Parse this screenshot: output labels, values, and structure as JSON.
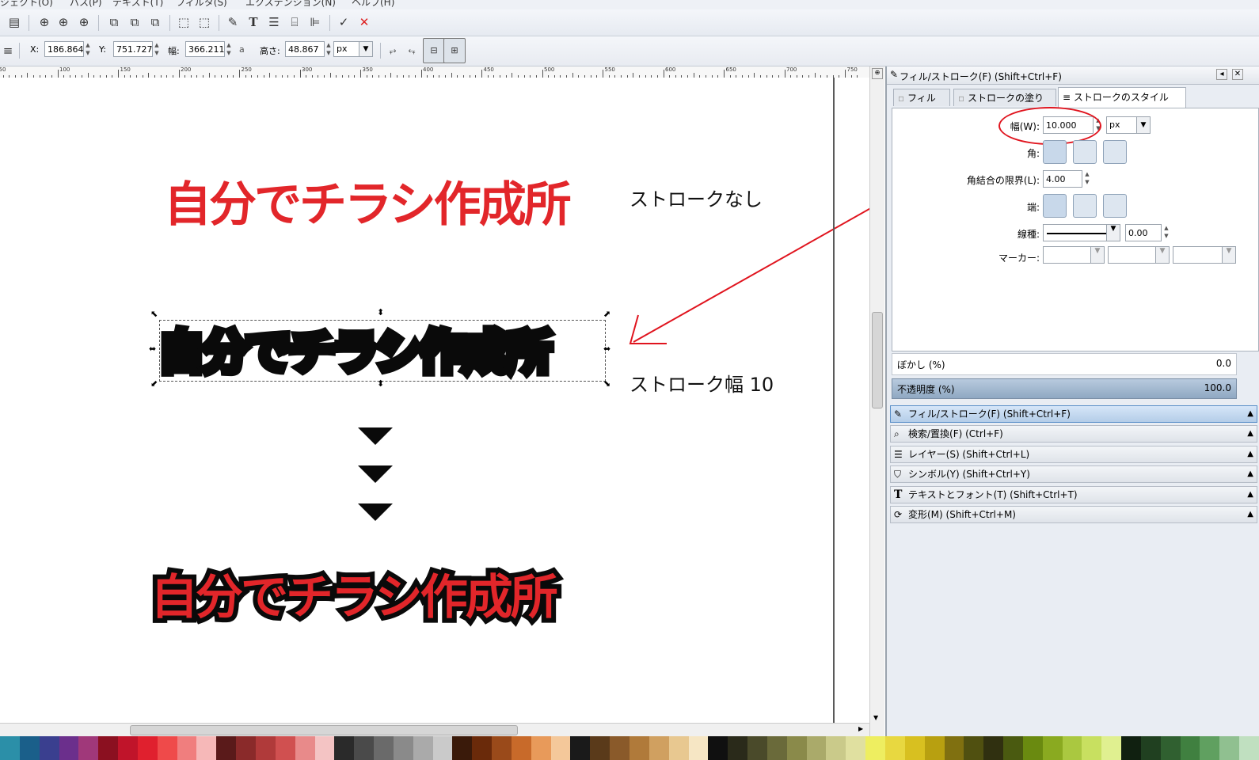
{
  "menubar": {
    "items": [
      "ジェクト(O)",
      "パス(P)",
      "テキスト(T)",
      "フィルタ(S)",
      "エクステンション(N)",
      "ヘルプ(H)"
    ]
  },
  "toolbar_controls": {
    "x_label": "X:",
    "x_value": "186.864",
    "y_label": "Y:",
    "y_value": "751.727",
    "w_label": "幅:",
    "w_value": "366.211",
    "h_label": "高さ:",
    "h_value": "48.867",
    "unit": "px"
  },
  "ruler": {
    "labels": [
      "50",
      "100",
      "150",
      "200",
      "250",
      "300",
      "350",
      "400",
      "450",
      "500",
      "550",
      "600",
      "650",
      "700",
      "750"
    ]
  },
  "canvas": {
    "title_text": "自分でチラシ作成所",
    "label_no_stroke": "ストロークなし",
    "label_stroke_width": "ストローク幅 10",
    "colors": {
      "red": "#e2262a",
      "black": "#0a0a0a"
    }
  },
  "panel": {
    "title": "フィル/ストローク(F) (Shift+Ctrl+F)",
    "tabs": [
      {
        "label": "フィル(F)"
      },
      {
        "label": "ストロークの塗り(P)"
      },
      {
        "label": "ストロークのスタイル(Y)"
      }
    ],
    "width_label": "幅(W):",
    "width_value": "10.000",
    "width_unit": "px",
    "join_label": "角:",
    "miter_label": "角結合の限界(L):",
    "miter_value": "4.00",
    "cap_label": "端:",
    "dash_label": "線種:",
    "dash_offset": "0.00",
    "markers_label": "マーカー:",
    "blur_label": "ぼかし (%)",
    "blur_value": "0.0",
    "opacity_label": "不透明度 (%)",
    "opacity_value": "100.0",
    "highlight_color": "#e0141e"
  },
  "dock_sections": [
    {
      "label": "フィル/ストローク(F) (Shift+Ctrl+F)",
      "icon": "pen-icon",
      "active": true
    },
    {
      "label": "検索/置換(F) (Ctrl+F)",
      "icon": "magnifier-icon"
    },
    {
      "label": "レイヤー(S) (Shift+Ctrl+L)",
      "icon": "layers-icon"
    },
    {
      "label": "シンボル(Y) (Shift+Ctrl+Y)",
      "icon": "symbol-icon"
    },
    {
      "label": "テキストとフォント(T) (Shift+Ctrl+T)",
      "icon": "text-icon"
    },
    {
      "label": "変形(M) (Shift+Ctrl+M)",
      "icon": "transform-icon"
    }
  ],
  "palette": [
    "#2b8fa8",
    "#1a5f8a",
    "#3a3f8f",
    "#6b2f8c",
    "#a0387a",
    "#8b1020",
    "#c0142a",
    "#e0202e",
    "#ef4a4a",
    "#f07e7e",
    "#f6b8b8",
    "#5a1a1a",
    "#8a2a2a",
    "#b03a3a",
    "#d05050",
    "#e88a8a",
    "#f4c4c4",
    "#2a2a2a",
    "#4a4a4a",
    "#6a6a6a",
    "#8a8a8a",
    "#aaaaaa",
    "#cacaca",
    "#3a1a0a",
    "#6a2a0a",
    "#9a4a1a",
    "#c86a2a",
    "#e89a5a",
    "#f4c89a",
    "#1a1a1a",
    "#5a3a1a",
    "#8a5a2a",
    "#b07a3a",
    "#d0a060",
    "#e8c890",
    "#f6e6c4",
    "#101010",
    "#2a2a1a",
    "#4a4a2a",
    "#6a6a3a",
    "#8a8a4a",
    "#aaaa6a",
    "#caca8a",
    "#e0e0a0",
    "#eeee60",
    "#e8d840",
    "#d8c020",
    "#b8a010",
    "#807010",
    "#505010",
    "#303010",
    "#4a5a10",
    "#6a8a10",
    "#8aaa20",
    "#aac840",
    "#c8e060",
    "#e0f090",
    "#102010",
    "#204020",
    "#306030",
    "#408040",
    "#60a060",
    "#90c090",
    "#c0e0c0"
  ]
}
